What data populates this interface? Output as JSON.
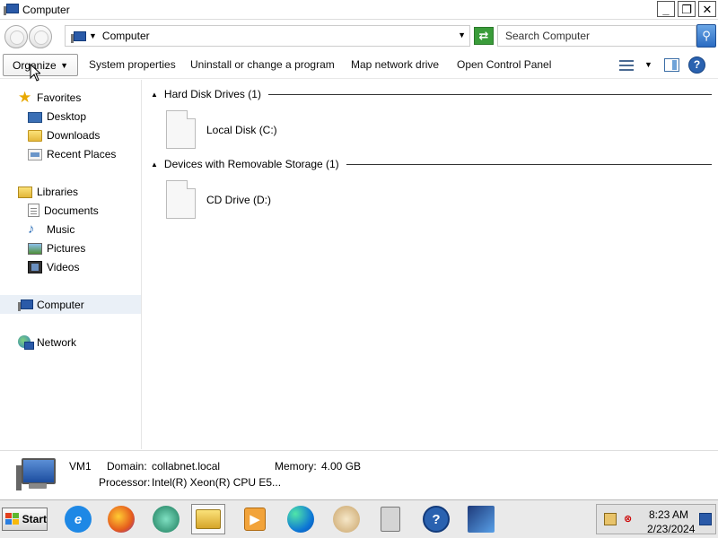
{
  "window": {
    "title": "Computer",
    "minimize": "_",
    "restore": "❐",
    "close": "✕"
  },
  "address": {
    "crumb": "Computer",
    "search_placeholder": "Search Computer"
  },
  "toolbar": {
    "organize": "Organize",
    "system_properties": "System properties",
    "uninstall": "Uninstall or change a program",
    "map_drive": "Map network drive",
    "control_panel": "Open Control Panel",
    "help": "?"
  },
  "nav": {
    "favorites": "Favorites",
    "desktop": "Desktop",
    "downloads": "Downloads",
    "recent_places": "Recent Places",
    "libraries": "Libraries",
    "documents": "Documents",
    "music": "Music",
    "pictures": "Pictures",
    "videos": "Videos",
    "computer": "Computer",
    "network": "Network"
  },
  "content": {
    "groups": [
      {
        "title": "Hard Disk Drives (1)",
        "items": [
          "Local Disk (C:)"
        ]
      },
      {
        "title": "Devices with Removable Storage (1)",
        "items": [
          "CD Drive (D:)"
        ]
      }
    ]
  },
  "details": {
    "name": "VM1",
    "domain_label": "Domain:",
    "domain": "collabnet.local",
    "memory_label": "Memory:",
    "memory": "4.00 GB",
    "processor_label": "Processor:",
    "processor": "Intel(R) Xeon(R) CPU E5..."
  },
  "taskbar": {
    "start": "Start",
    "time": "8:23 AM",
    "date": "2/23/2024",
    "apps": [
      "internet-explorer-icon",
      "firefox-icon",
      "edge-beta-icon",
      "file-explorer-icon",
      "media-player-icon",
      "edge-icon",
      "paint-icon",
      "calculator-icon",
      "help-icon",
      "app-icon"
    ]
  },
  "colors": {
    "selection": "#eaf0f7",
    "accent_blue": "#2a62b0",
    "refresh_green": "#3a9c3a"
  }
}
